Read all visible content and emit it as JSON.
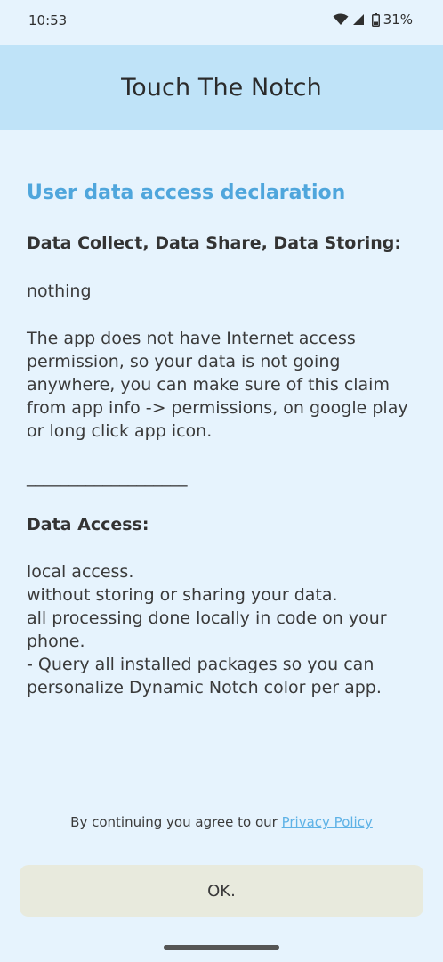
{
  "status_bar": {
    "time": "10:53",
    "battery": "31%"
  },
  "app_bar": {
    "title": "Touch The Notch"
  },
  "content": {
    "section_title": "User data access declaration",
    "collect_heading": "Data Collect, Data Share, Data Storing:",
    "collect_value": "nothing",
    "collect_body": "The app does not have Internet access permission, so your data is not going anywhere, you can make sure of this claim from app info -> permissions, on google play or long click app icon.",
    "divider": "___________________",
    "access_heading": "Data Access:",
    "access_body": "local access.\nwithout storing or sharing your data.\nall processing done locally in code on your phone.\n- Query all installed packages so you can personalize Dynamic Notch color per app."
  },
  "footer": {
    "agree_text": "By continuing you agree to our ",
    "privacy_link": "Privacy Policy"
  },
  "actions": {
    "ok_label": "OK."
  }
}
